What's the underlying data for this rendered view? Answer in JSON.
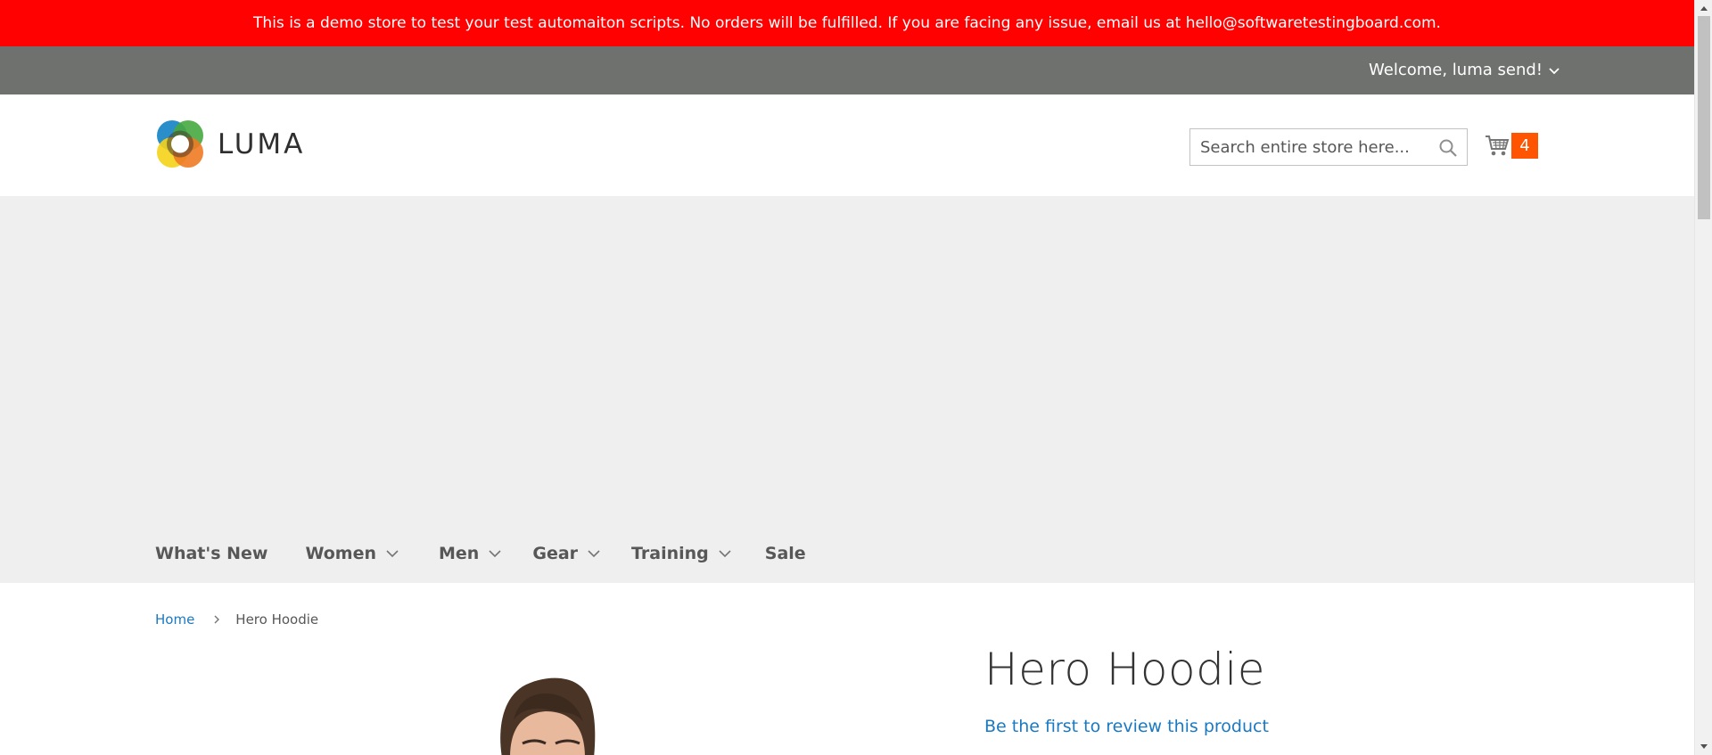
{
  "banner": {
    "text": "This is a demo store to test your test automaiton scripts. No orders will be fulfilled. If you are facing any issue, email us at hello@softwaretestingboard.com."
  },
  "top_bar": {
    "welcome": "Welcome, luma send!"
  },
  "header": {
    "logo_text": "LUMA",
    "search": {
      "placeholder": "Search entire store here..."
    },
    "cart": {
      "count": "4"
    }
  },
  "nav": {
    "items": [
      {
        "label": "What's New",
        "has_dropdown": false
      },
      {
        "label": "Women",
        "has_dropdown": true
      },
      {
        "label": "Men",
        "has_dropdown": true
      },
      {
        "label": "Gear",
        "has_dropdown": true
      },
      {
        "label": "Training",
        "has_dropdown": true
      },
      {
        "label": "Sale",
        "has_dropdown": false
      }
    ]
  },
  "breadcrumbs": {
    "home": "Home",
    "current": "Hero Hoodie"
  },
  "product": {
    "title": "Hero Hoodie",
    "review_link": "Be the first to review this product"
  },
  "colors": {
    "banner_bg": "#ff0101",
    "top_bar_bg": "#6e716e",
    "nav_bg": "#efefef",
    "link": "#1979c3",
    "cart_counter": "#ff5501"
  },
  "icons": [
    "chevron-down-icon",
    "search-icon",
    "cart-icon",
    "chevron-right-icon"
  ]
}
